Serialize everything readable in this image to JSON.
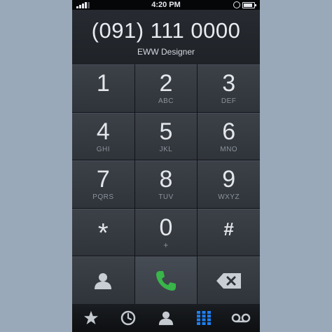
{
  "status_bar": {
    "time": "4:20 PM",
    "left_icon": "signal-icon",
    "right_icons": [
      "clock-icon",
      "battery-icon"
    ]
  },
  "display": {
    "phone_number": "(091) 111 0000",
    "contact_name": "EWW Designer"
  },
  "keypad": {
    "keys": [
      {
        "digit": "1",
        "letters": ""
      },
      {
        "digit": "2",
        "letters": "ABC"
      },
      {
        "digit": "3",
        "letters": "DEF"
      },
      {
        "digit": "4",
        "letters": "GHI"
      },
      {
        "digit": "5",
        "letters": "JKL"
      },
      {
        "digit": "6",
        "letters": "MNO"
      },
      {
        "digit": "7",
        "letters": "PQRS"
      },
      {
        "digit": "8",
        "letters": "TUV"
      },
      {
        "digit": "9",
        "letters": "WXYZ"
      },
      {
        "digit": "*",
        "letters": ""
      },
      {
        "digit": "0",
        "letters": "+"
      },
      {
        "digit": "#",
        "letters": ""
      }
    ],
    "bottom_row": [
      "add-contact-icon",
      "call-icon",
      "backspace-icon"
    ]
  },
  "tabs": [
    {
      "icon": "star-icon",
      "name": "favorites"
    },
    {
      "icon": "clock-icon",
      "name": "recents"
    },
    {
      "icon": "person-icon",
      "name": "contacts"
    },
    {
      "icon": "keypad-icon",
      "name": "keypad",
      "active": true
    },
    {
      "icon": "voicemail-icon",
      "name": "voicemail"
    }
  ],
  "colors": {
    "accent": "#1e7ff2",
    "call_green": "#39b54a",
    "background": "#9aa9b9"
  }
}
